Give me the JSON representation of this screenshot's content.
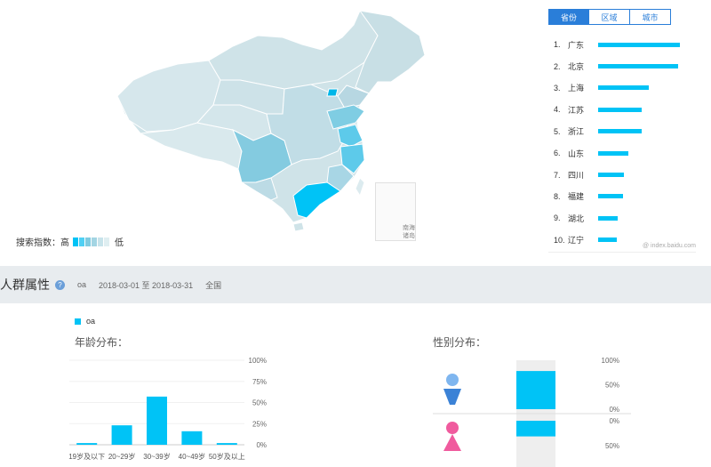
{
  "map": {
    "legend_label": "搜索指数：高",
    "legend_low": "低",
    "legend_colors": [
      "#00c3f6",
      "#4fd0f4",
      "#7fcbe0",
      "#a3d5e3",
      "#c7e3ea",
      "#dfeef1"
    ],
    "scheme_label": "南海诸岛"
  },
  "ranking": {
    "tabs": [
      {
        "label": "省份",
        "active": true
      },
      {
        "label": "区域",
        "active": false
      },
      {
        "label": "城市",
        "active": false
      }
    ],
    "items": [
      {
        "rank": "1.",
        "name": "广东",
        "value": 1.0
      },
      {
        "rank": "2.",
        "name": "北京",
        "value": 0.98
      },
      {
        "rank": "3.",
        "name": "上海",
        "value": 0.62
      },
      {
        "rank": "4.",
        "name": "江苏",
        "value": 0.53
      },
      {
        "rank": "5.",
        "name": "浙江",
        "value": 0.53
      },
      {
        "rank": "6.",
        "name": "山东",
        "value": 0.37
      },
      {
        "rank": "7.",
        "name": "四川",
        "value": 0.32
      },
      {
        "rank": "8.",
        "name": "福建",
        "value": 0.3
      },
      {
        "rank": "9.",
        "name": "湖北",
        "value": 0.24
      },
      {
        "rank": "10.",
        "name": "辽宁",
        "value": 0.23
      }
    ],
    "credit": "@ index.baidu.com"
  },
  "section": {
    "title": "人群属性",
    "keyword": "oa",
    "date_range": "2018-03-01 至 2018-03-31",
    "region": "全国"
  },
  "series_legend": "oa",
  "colors": {
    "accent": "#00c3f6",
    "tab": "#2a7ed9",
    "male": "#7fb6ef",
    "female": "#f05b9e"
  },
  "chart_data": [
    {
      "type": "bar",
      "title": "年龄分布：",
      "categories": [
        "19岁及以下",
        "20~29岁",
        "30~39岁",
        "40~49岁",
        "50岁及以上"
      ],
      "series": [
        {
          "name": "oa",
          "values": [
            2,
            23,
            57,
            16,
            2
          ]
        }
      ],
      "ylim": [
        0,
        100
      ],
      "yticks": [
        "0%",
        "25%",
        "50%",
        "75%",
        "100%"
      ]
    },
    {
      "type": "bar",
      "title": "性别分布：",
      "categories": [
        "男",
        "女"
      ],
      "series": [
        {
          "name": "oa",
          "values": [
            78,
            32
          ]
        }
      ],
      "ylim": [
        0,
        100
      ],
      "yticks_top": [
        "0%",
        "50%",
        "100%"
      ],
      "yticks_bottom": [
        "0%",
        "50%"
      ]
    }
  ]
}
